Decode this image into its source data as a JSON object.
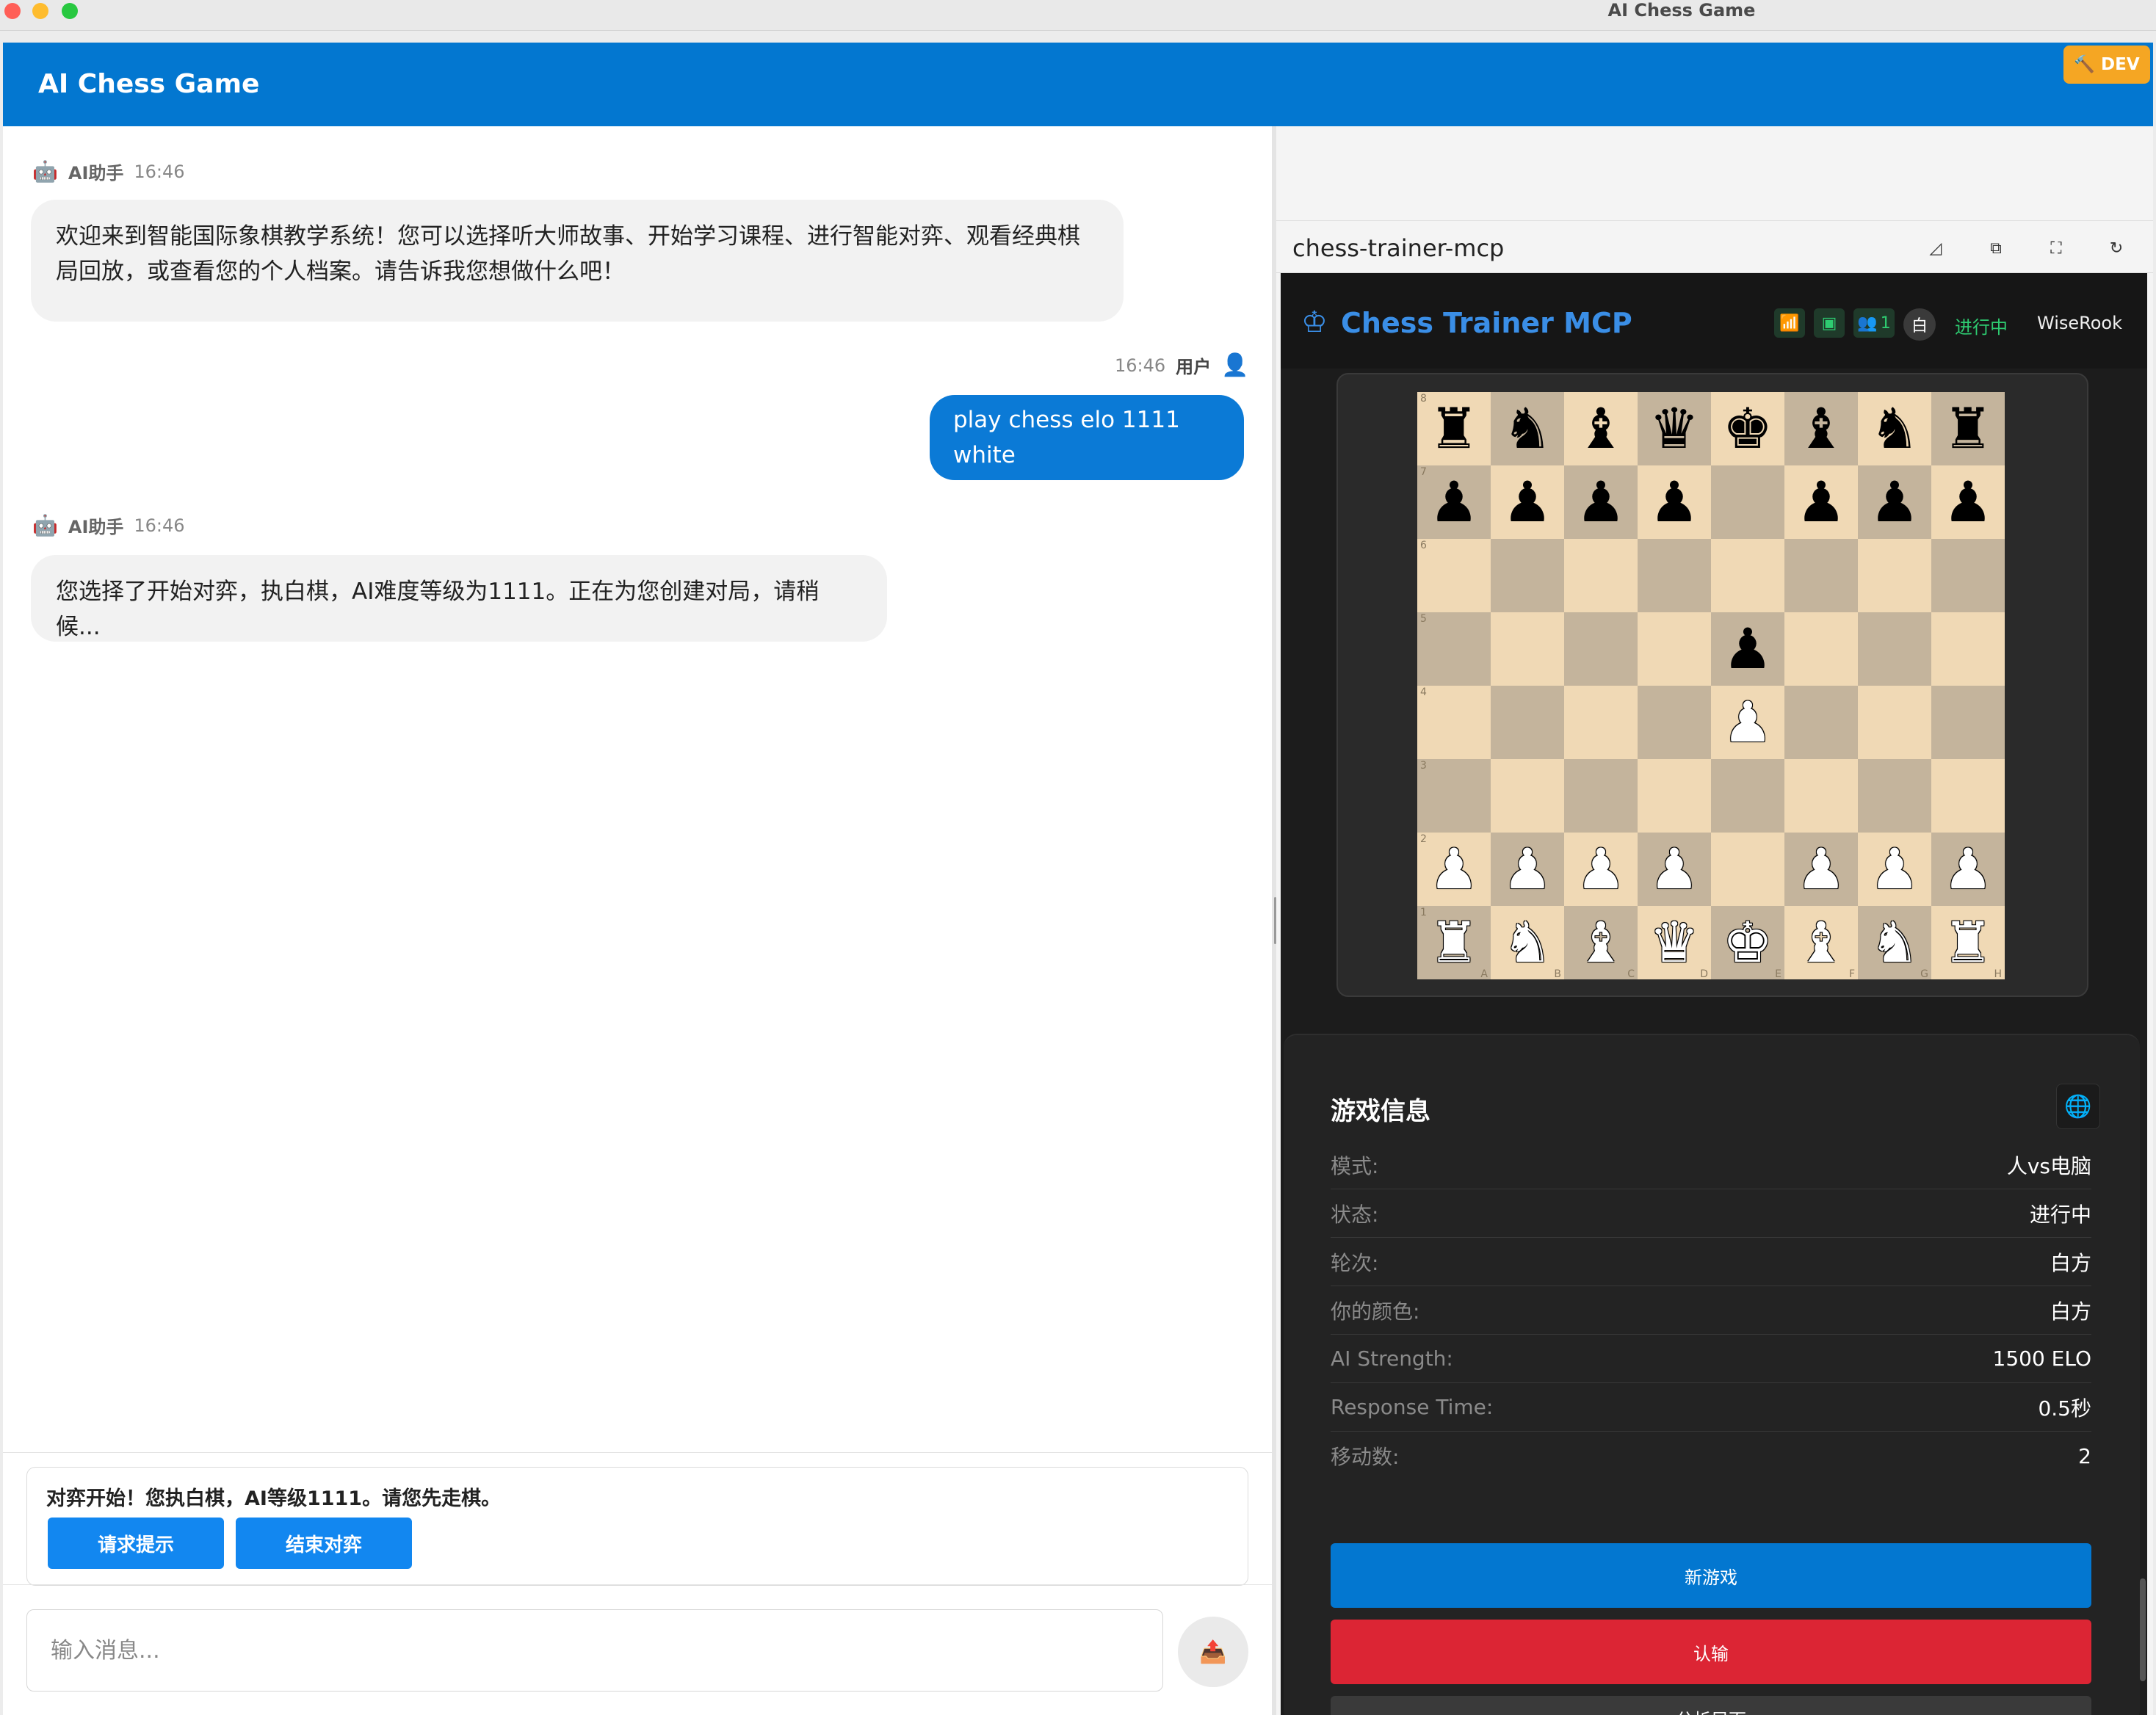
{
  "window": {
    "title": "AI Chess Game"
  },
  "header": {
    "title": "AI Chess Game",
    "dev_badge": "🔨 DEV"
  },
  "chat": {
    "messages": [
      {
        "role": "ai",
        "sender": "AI助手",
        "time": "16:46",
        "text": "欢迎来到智能国际象棋教学系统！您可以选择听大师故事、开始学习课程、进行智能对弈、观看经典棋局回放，或查看您的个人档案。请告诉我您想做什么吧！"
      },
      {
        "role": "user",
        "sender": "用户",
        "time": "16:46",
        "text": "play chess elo 1111 white"
      },
      {
        "role": "ai",
        "sender": "AI助手",
        "time": "16:46",
        "text": "您选择了开始对弈，执白棋，AI难度等级为1111。正在为您创建对局，请稍候..."
      }
    ],
    "action": {
      "text": "对弈开始！您执白棋，AI等级1111。请您先走棋。",
      "hint_button": "请求提示",
      "end_button": "结束对弈"
    },
    "input_placeholder": "输入消息...",
    "send_icon": "send-icon"
  },
  "mcp": {
    "name": "chess-trainer-mcp",
    "toolbar_icons": [
      "pin-icon",
      "popout-icon",
      "fullscreen-icon",
      "refresh-icon"
    ],
    "app_title": "Chess Trainer MCP",
    "player_count": "1",
    "color": "白",
    "status": "进行中",
    "player_name": "WiseRook",
    "board": {
      "ranks": [
        "8",
        "7",
        "6",
        "5",
        "4",
        "3",
        "2",
        "1"
      ],
      "files": [
        "A",
        "B",
        "C",
        "D",
        "E",
        "F",
        "G",
        "H"
      ],
      "position": [
        [
          "bR",
          "bN",
          "bB",
          "bQ",
          "bK",
          "bB",
          "bN",
          "bR"
        ],
        [
          "bP",
          "bP",
          "bP",
          "bP",
          "",
          "bP",
          "bP",
          "bP"
        ],
        [
          "",
          "",
          "",
          "",
          "",
          "",
          "",
          ""
        ],
        [
          "",
          "",
          "",
          "",
          "bP",
          "",
          "",
          ""
        ],
        [
          "",
          "",
          "",
          "",
          "wP",
          "",
          "",
          ""
        ],
        [
          "",
          "",
          "",
          "",
          "",
          "",
          "",
          ""
        ],
        [
          "wP",
          "wP",
          "wP",
          "wP",
          "",
          "wP",
          "wP",
          "wP"
        ],
        [
          "wR",
          "wN",
          "wB",
          "wQ",
          "wK",
          "wB",
          "wN",
          "wR"
        ]
      ]
    },
    "info": {
      "title": "游戏信息",
      "rows": [
        {
          "k": "模式:",
          "v": "人vs电脑"
        },
        {
          "k": "状态:",
          "v": "进行中"
        },
        {
          "k": "轮次:",
          "v": "白方"
        },
        {
          "k": "你的颜色:",
          "v": "白方"
        },
        {
          "k": "AI Strength:",
          "v": "1500 ELO"
        },
        {
          "k": "Response Time:",
          "v": "0.5秒"
        },
        {
          "k": "移动数:",
          "v": "2"
        }
      ],
      "new_game": "新游戏",
      "resign": "认输",
      "analyze": "分析局面"
    },
    "colors": {
      "accent": "#3a8ee6",
      "green": "#2ecc71",
      "blue_btn": "#0377d0",
      "red_btn": "#dc2534"
    }
  }
}
